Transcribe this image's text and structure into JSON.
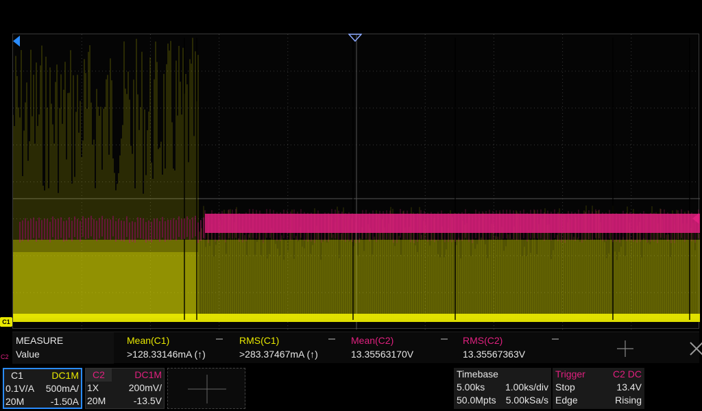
{
  "colors": {
    "ch1": "#e8e800",
    "ch2": "#e0207f",
    "accent": "#2a8cff",
    "grid": "#3a3a3a"
  },
  "markers": {
    "ch1_tag": "C1",
    "ch2_tag": "C2"
  },
  "measure": {
    "header_label": "MEASURE",
    "row_label": "Value",
    "items": [
      {
        "name": "Mean(C1)",
        "value": ">128.33146mA (↑)",
        "color": "#e8e800"
      },
      {
        "name": "RMS(C1)",
        "value": ">283.37467mA (↑)",
        "color": "#e8e800"
      },
      {
        "name": "Mean(C2)",
        "value": "13.35563170V",
        "color": "#e0207f"
      },
      {
        "name": "RMS(C2)",
        "value": "13.35567363V",
        "color": "#e0207f"
      }
    ]
  },
  "channels": {
    "ch1": {
      "label": "C1",
      "coupling": "DC1M",
      "probe": "0.1V/A",
      "scale": "500mA/",
      "bandwidth": "20M",
      "offset": "-1.50A"
    },
    "ch2": {
      "label": "C2",
      "coupling": "DC1M",
      "probe": "1X",
      "scale": "200mV/",
      "bandwidth": "20M",
      "offset": "-13.5V"
    }
  },
  "timebase": {
    "title": "Timebase",
    "delay": "5.00ks",
    "scale": "1.00ks/div",
    "memory_depth": "50.0Mpts",
    "sample_rate": "5.00kSa/s"
  },
  "trigger": {
    "title": "Trigger",
    "source": "C2",
    "coupling": "DC",
    "mode": "Stop",
    "level": "13.4V",
    "type": "Edge",
    "slope": "Rising"
  },
  "icons": {
    "measure_add": "plus-icon",
    "measure_close": "close-icon",
    "channel_add": "plus-icon"
  }
}
